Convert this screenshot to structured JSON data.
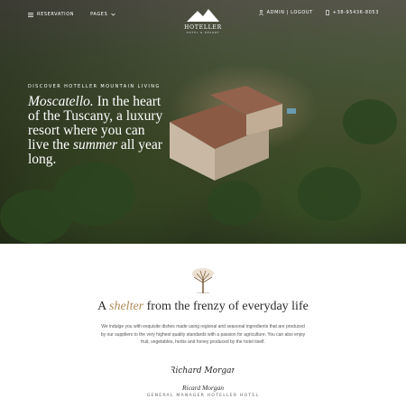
{
  "header": {
    "nav_left": [
      {
        "label": "Reservation",
        "icon": "menu-icon"
      },
      {
        "label": "Pages",
        "icon": "chevron-down-icon"
      }
    ],
    "logo": {
      "name": "HOTELLER",
      "tagline": "HOTEL & RESORT"
    },
    "account_label": "ADMIN | LOGOUT",
    "phone": "+38-95436-8053"
  },
  "hero": {
    "eyebrow": "Discover Hoteller Mountain Living",
    "headline_place": "Moscatello.",
    "headline_part1": "In the heart of the Tuscany, a luxury resort where you can live the",
    "headline_accent": "summer",
    "headline_part2": "all year long."
  },
  "intro": {
    "title_prefix": "A",
    "title_accent": "shelter",
    "title_suffix": "from the frenzy of everyday life",
    "body": "We indulge you with exquisite dishes made using regional and seasonal ingredients that are produced by our suppliers to the very highest quality standards with a passion for agriculture. You can also enjoy fruit, vegetables, herbs and honey produced by the hotel itself.",
    "signature_text": "Richard Morgan",
    "signer_name": "Ricard Morgan",
    "signer_role": "General Manager Hoteller Hotel"
  },
  "colors": {
    "accent": "#b08a55",
    "text": "#222222"
  }
}
